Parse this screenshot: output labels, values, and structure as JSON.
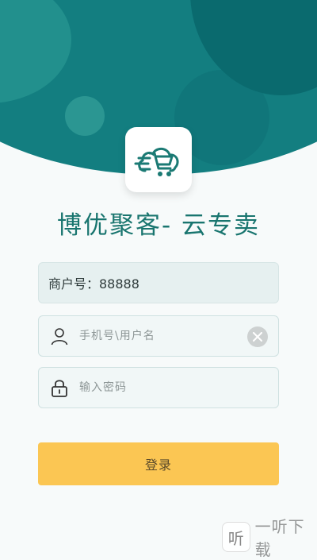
{
  "app": {
    "title": "博优聚客- 云专卖"
  },
  "form": {
    "merchant_text": "商户号：88888",
    "username_placeholder": "手机号\\用户名",
    "password_placeholder": "输入密码",
    "login_label": "登录"
  },
  "icons": {
    "logo": "cart-cloud-icon",
    "user": "user-icon",
    "password": "lock-icon",
    "clear": "clear-icon"
  },
  "watermark": {
    "logo_text": "听",
    "text": "一听下载"
  },
  "colors": {
    "header": "#137e80",
    "accent": "#19756f",
    "button": "#fbc653"
  }
}
